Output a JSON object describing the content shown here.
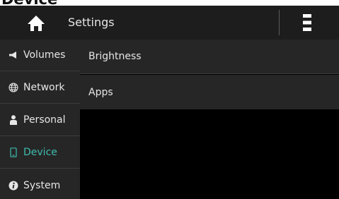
{
  "page_heading": "Device",
  "header": {
    "home_icon": "home-icon",
    "title": "Settings",
    "menu_icon": "menu-icon"
  },
  "sidebar": {
    "items": [
      {
        "label": "Volumes",
        "icon": "speaker-icon"
      },
      {
        "label": "Network",
        "icon": "globe-icon"
      },
      {
        "label": "Personal",
        "icon": "person-icon"
      },
      {
        "label": "Device",
        "icon": "phone-icon",
        "active": true
      },
      {
        "label": "System",
        "icon": "info-icon"
      }
    ]
  },
  "content": {
    "items": [
      {
        "label": "Brightness"
      },
      {
        "label": "Apps"
      }
    ]
  },
  "colors": {
    "accent": "#3fbcae",
    "header_bg": "#1d1d1d",
    "sidebar_bg": "#262626",
    "content_bg": "#000000",
    "text": "#e6e6e6"
  }
}
